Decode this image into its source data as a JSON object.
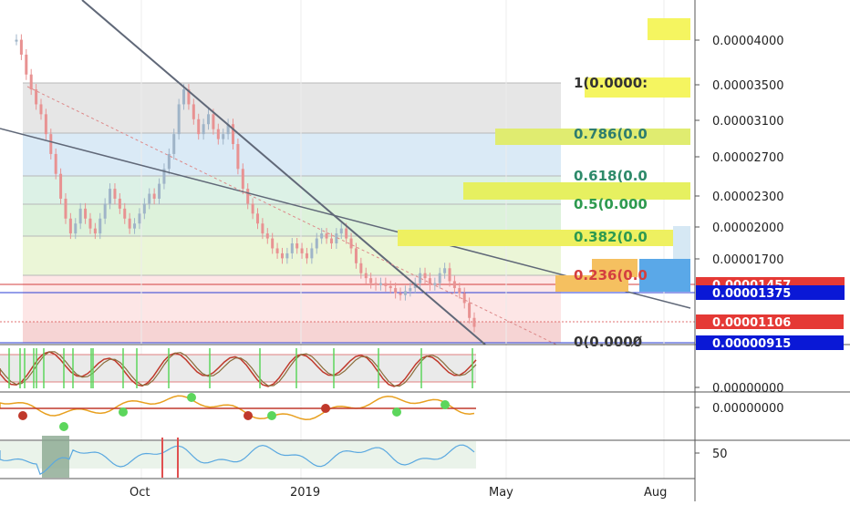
{
  "colors": {
    "candle_up": "#9fb4c8",
    "candle_down": "#e89292",
    "fib_0": "#f4cccc",
    "fib_236": "#fde2e2",
    "fib_382": "#e8f5d0",
    "fib_5": "#d7f0d5",
    "fib_618": "#d6efe2",
    "fib_786": "#d3e6f5",
    "fib_1": "#e2e2e2",
    "red_label": "#e53935",
    "blue_label": "#0a18d6",
    "yellow_zone": "#f5f560",
    "green_marker": "#5cd65c"
  },
  "x_axis": {
    "ticks": [
      "Oct",
      "2019",
      "May",
      "Aug"
    ]
  },
  "y_axis": {
    "ticks": [
      "0.00004000",
      "0.00003500",
      "0.00003100",
      "0.00002700",
      "0.00002300",
      "0.00002000",
      "0.00001700"
    ]
  },
  "fib_levels": [
    {
      "label": "1(0.0000:"
    },
    {
      "label": "0.786(0.0"
    },
    {
      "label": "0.618(0.0"
    },
    {
      "label": "0.5(0.000"
    },
    {
      "label": "0.382(0.0"
    },
    {
      "label": "0.236(0.0"
    },
    {
      "label": "0(0.0000̸"
    }
  ],
  "price_tags": [
    {
      "value": "0.00001457",
      "style": "red"
    },
    {
      "value": "0.00001375",
      "style": "blue"
    },
    {
      "value": "0.00001106",
      "style": "red"
    },
    {
      "value": "0.00000915",
      "style": "blue"
    }
  ],
  "stoch_axis": {
    "value": "0.00000000"
  },
  "macd_axis": {
    "value": "0.00000000"
  },
  "rsi_axis": {
    "value": "50"
  },
  "chart_data": {
    "type": "candlestick",
    "title": "",
    "x_ticks": [
      "Oct",
      "2019",
      "May",
      "Aug"
    ],
    "y_ticks": [
      4e-05,
      3.5e-05,
      3.1e-05,
      2.7e-05,
      2.3e-05,
      2e-05,
      1.7e-05
    ],
    "fib_retracement": [
      "1",
      "0.786",
      "0.618",
      "0.5",
      "0.382",
      "0.236",
      "0"
    ],
    "price_tags": [
      1.457e-05,
      1.375e-05,
      1.106e-05,
      9.15e-06
    ],
    "close_series": [
      3.95e-05,
      3.8e-05,
      3.6e-05,
      3.45e-05,
      3.3e-05,
      3.2e-05,
      3e-05,
      2.8e-05,
      2.6e-05,
      2.35e-05,
      2.15e-05,
      2e-05,
      2.1e-05,
      2.25e-05,
      2.15e-05,
      2.05e-05,
      2e-05,
      2.15e-05,
      2.3e-05,
      2.45e-05,
      2.35e-05,
      2.25e-05,
      2.15e-05,
      2.05e-05,
      2.1e-05,
      2.2e-05,
      2.3e-05,
      2.4e-05,
      2.35e-05,
      2.5e-05,
      2.65e-05,
      2.8e-05,
      3e-05,
      3.3e-05,
      3.45e-05,
      3.3e-05,
      3.15e-05,
      3e-05,
      3.1e-05,
      3.2e-05,
      3.05e-05,
      2.95e-05,
      3e-05,
      3.1e-05,
      2.9e-05,
      2.65e-05,
      2.45e-05,
      2.3e-05,
      2.2e-05,
      2.1e-05,
      2e-05,
      1.95e-05,
      1.85e-05,
      1.8e-05,
      1.75e-05,
      1.8e-05,
      1.9e-05,
      1.85e-05,
      1.8e-05,
      1.75e-05,
      1.85e-05,
      1.95e-05,
      2e-05,
      1.95e-05,
      1.9e-05,
      2e-05,
      2.05e-05,
      1.95e-05,
      1.85e-05,
      1.7e-05,
      1.6e-05,
      1.55e-05,
      1.5e-05,
      1.48e-05,
      1.5e-05,
      1.47e-05,
      1.45e-05,
      1.4e-05,
      1.38e-05,
      1.42e-05,
      1.45e-05,
      1.5e-05,
      1.6e-05,
      1.55e-05,
      1.48e-05,
      1.5e-05,
      1.6e-05,
      1.65e-05,
      1.52e-05,
      1.45e-05,
      1.4e-05,
      1.3e-05,
      1.15e-05,
      1.06e-05
    ],
    "ylim": [
      9e-06,
      4.35e-05
    ]
  }
}
